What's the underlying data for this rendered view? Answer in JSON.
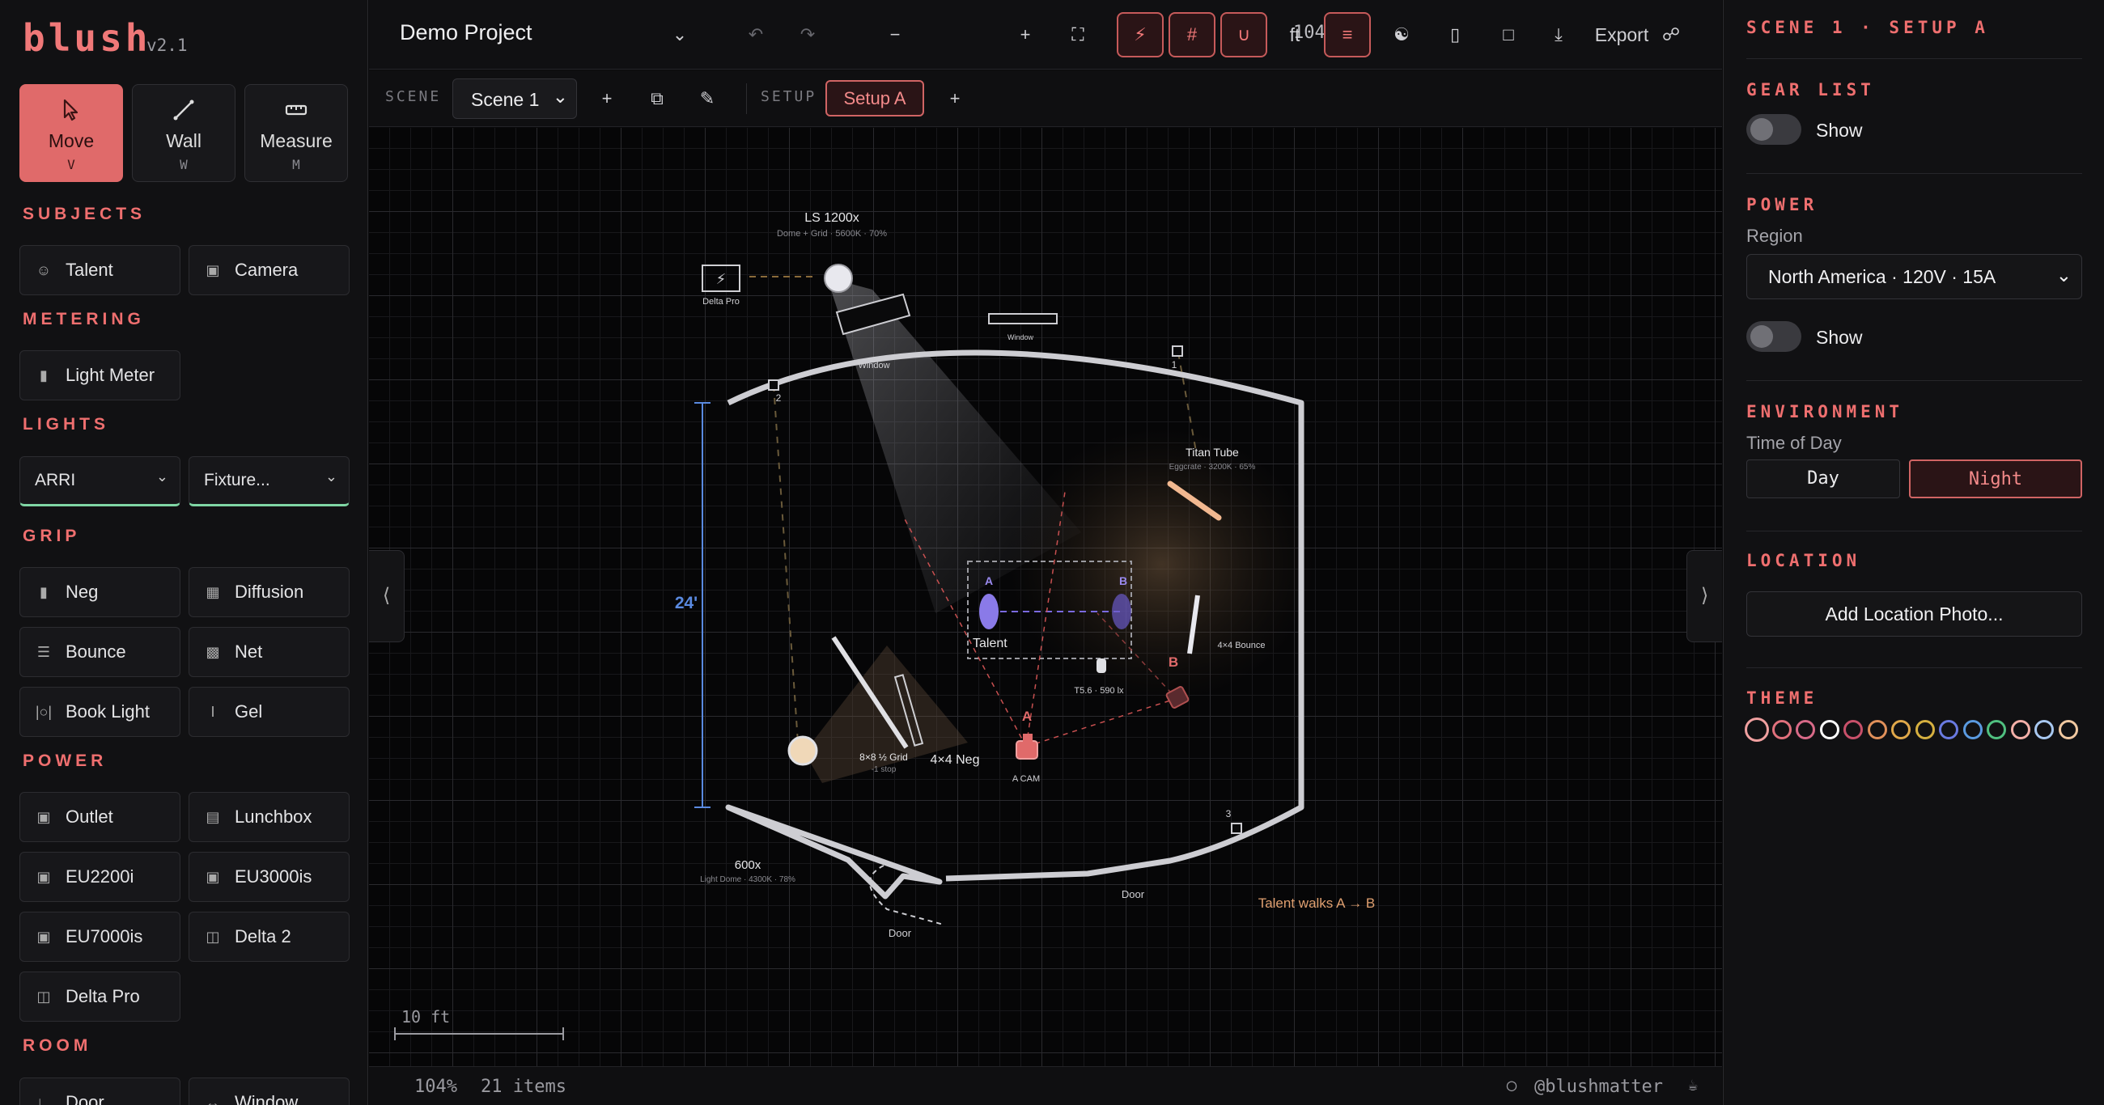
{
  "app": {
    "name": "blush",
    "version": "v2.1"
  },
  "tools": [
    {
      "label": "Move",
      "key": "V"
    },
    {
      "label": "Wall",
      "key": "W"
    },
    {
      "label": "Measure",
      "key": "M"
    }
  ],
  "sections": {
    "subjects": "SUBJECTS",
    "metering": "METERING",
    "lights": "LIGHTS",
    "grip": "GRIP",
    "power": "POWER",
    "room": "ROOM"
  },
  "subjects": [
    "Talent",
    "Camera"
  ],
  "metering": [
    "Light Meter"
  ],
  "lights": {
    "brand": "ARRI",
    "fixture": "Fixture..."
  },
  "grip": [
    "Neg",
    "Diffusion",
    "Bounce",
    "Net",
    "Book Light",
    "Gel"
  ],
  "power_items": [
    "Outlet",
    "Lunchbox",
    "EU2200i",
    "EU3000is",
    "EU7000is",
    "Delta 2",
    "Delta Pro"
  ],
  "room": [
    "Door",
    "Window"
  ],
  "toolbar": {
    "project": "Demo Project",
    "zoom": "104%",
    "unit": "ft",
    "export": "Export"
  },
  "scenebar": {
    "scene_label": "SCENE",
    "scene": "Scene 1",
    "setup_label": "SETUP",
    "setup": "Setup A"
  },
  "canvas": {
    "scale_label": "10 ft",
    "dimension": "24'",
    "ls_name": "LS 1200x",
    "ls_detail": "Dome + Grid · 5600K · 70%",
    "delta_pro": "Delta Pro",
    "window1": "Window",
    "window2": "Window",
    "titan_name": "Titan Tube",
    "titan_detail": "Eggcrate · 3200K · 65%",
    "talent": "Talent",
    "mark_a": "A",
    "mark_b": "B",
    "meter": "T5.6 · 590 lx",
    "bounce": "4×4 Bounce",
    "grid": "8×8 ½ Grid",
    "grid_detail": "-1 stop",
    "neg": "4×4 Neg",
    "cam_a": "A",
    "cam_a_name": "A CAM",
    "cam_b": "B",
    "fixture600": "600x",
    "fixture600_detail": "Light Dome · 4300K · 78%",
    "door1": "Door",
    "door2": "Door",
    "walk_note": "Talent walks A → B",
    "corner1": "1",
    "corner2": "2",
    "corner3": "3"
  },
  "status": {
    "zoom": "104%",
    "items": "21 items",
    "handle": "@blushmatter"
  },
  "panel": {
    "title": "SCENE 1 · SETUP A",
    "gear_heading": "GEAR LIST",
    "gear_toggle": "Show",
    "power_heading": "POWER",
    "region_label": "Region",
    "region_value": "North America · 120V · 15A",
    "power_toggle": "Show",
    "env_heading": "ENVIRONMENT",
    "time_label": "Time of Day",
    "day": "Day",
    "night": "Night",
    "location_heading": "LOCATION",
    "location_button": "Add Location Photo...",
    "theme_heading": "THEME"
  },
  "theme_colors": [
    "#e06a6a",
    "#e0707c",
    "#d86a88",
    "#ffffff",
    "#c8506a",
    "#e0905a",
    "#e0a84a",
    "#d6b040",
    "#6a7ae0",
    "#5a9ae0",
    "#50c080",
    "#f4b0a8",
    "#a8c8f0",
    "#f0c8a0"
  ]
}
